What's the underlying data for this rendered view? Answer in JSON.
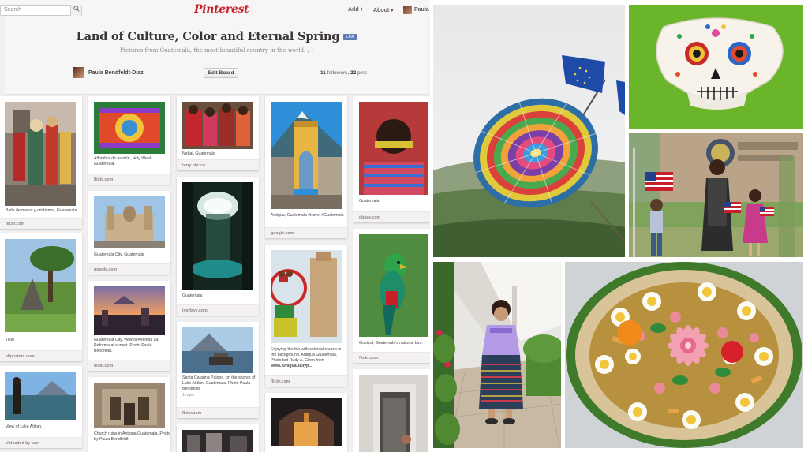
{
  "topbar": {
    "search_placeholder": "Search",
    "logo": "Pinterest",
    "add_label": "Add +",
    "about_label": "About ▾",
    "user_label": "Paula"
  },
  "board": {
    "title": "Land of Culture, Color and Eternal Spring",
    "like_label": "Like",
    "description": "Pictures from Guatemala, the most beautiful country in the world. ;-)",
    "owner": "Paula Bendfeldt-Diaz",
    "edit_label": "Edit Board",
    "followers_count": "11",
    "followers_word": "followers,",
    "pins_count": "22",
    "pins_word": "pins"
  },
  "pins": [
    {
      "caption": "Baile de moros y cristianos, Guatemala",
      "source": "flickr.com"
    },
    {
      "caption": "Tikal",
      "source": "allposters.com"
    },
    {
      "caption": "View of Lake Atitlan.",
      "source": "Uploaded by user"
    },
    {
      "caption": "Alfombra de aserrín, Holy Week Guatemala.",
      "source": "flickr.com"
    },
    {
      "caption": "Guatemala City, Guatemala",
      "source": "google.com"
    },
    {
      "caption": "Guatemala City, view of Avenida La Reforma at sunset. Photo Paula Bendfeldt.",
      "source": "flickr.com"
    },
    {
      "caption": "Church ruins in Antigua Guatemala. Photo by Paula Bendfeldt.",
      "source": ""
    },
    {
      "caption": "Nebaj, Guatemala",
      "source": "terry.ubc.ca"
    },
    {
      "caption": "Guatemala",
      "source": "imgfave.com"
    },
    {
      "caption": "Santa Catarina Palopo, on the shores of Lake Atitlan, Guatemala. Photo Paula Bendfeldt.",
      "repin": "1 repin",
      "source": "flickr.com"
    },
    {
      "caption": "Antigua, Guatemala #travel #Guatemala",
      "source": "google.com"
    },
    {
      "caption": "Enjoying the fair with colonial church in the background. Antigua Guatemala. Photo but Rudy A. Giron from",
      "caption_bold": "www.AntiguaDailyp...",
      "source": "flickr.com"
    },
    {
      "caption": "Guatemala",
      "source": "pbase.com"
    },
    {
      "caption": "Quetzal, Guatemala's national bird.",
      "source": "flickr.com"
    }
  ],
  "colors": {
    "pinterest_red": "#c8232c",
    "like_blue": "#5d7bb3",
    "background": "#f1efef"
  }
}
